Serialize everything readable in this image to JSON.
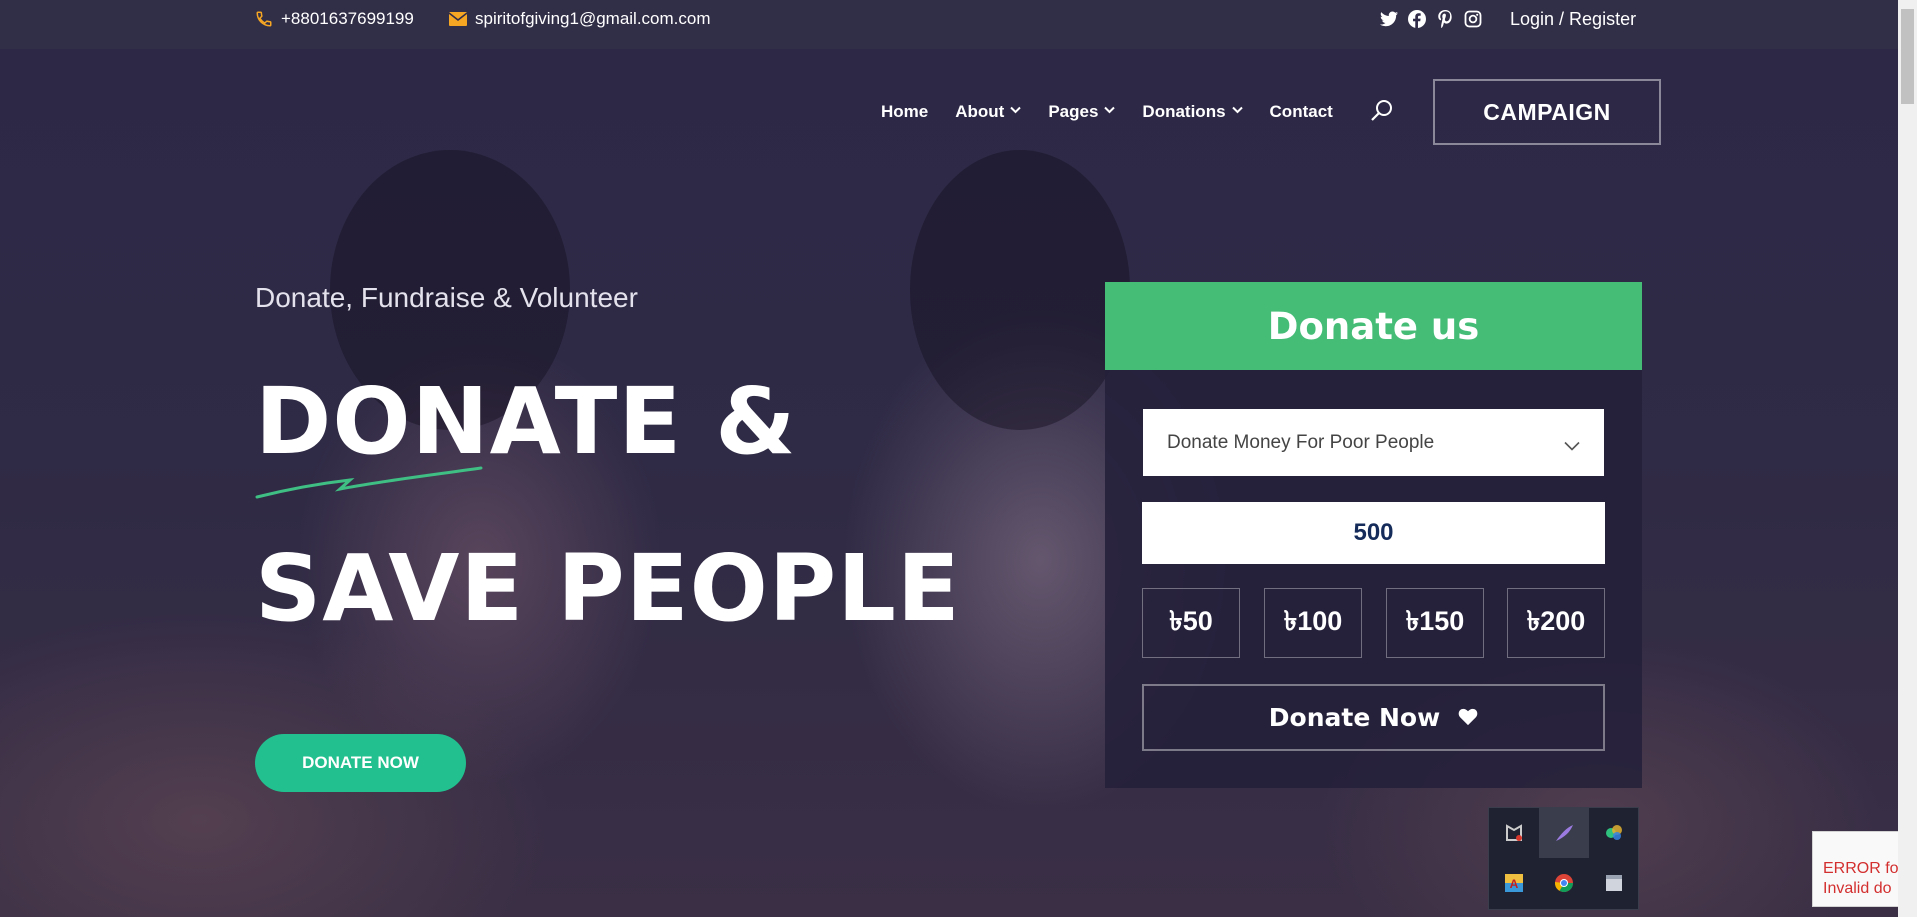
{
  "topbar": {
    "phone": "+8801637699199",
    "email": "spiritofgiving1@gmail.com.com",
    "socials": [
      "twitter-icon",
      "facebook-icon",
      "pinterest-icon",
      "instagram-icon"
    ],
    "login": "Login / Register"
  },
  "nav": {
    "items": [
      {
        "label": "Home",
        "dropdown": false
      },
      {
        "label": "About",
        "dropdown": true
      },
      {
        "label": "Pages",
        "dropdown": true
      },
      {
        "label": "Donations",
        "dropdown": true
      },
      {
        "label": "Contact",
        "dropdown": false
      }
    ],
    "campaign": "CAMPAIGN"
  },
  "hero": {
    "tagline": "Donate, Fundraise & Volunteer",
    "line1": "DONATE &",
    "line2": "SAVE PEOPLE",
    "cta": "DONATE NOW"
  },
  "card": {
    "title": "Donate us",
    "select_value": "Donate Money For Poor People",
    "amount": "500",
    "presets": [
      "৳50",
      "৳100",
      "৳150",
      "৳200"
    ],
    "donate_button": "Donate Now"
  },
  "recaptcha": {
    "line1": "ERROR fo",
    "line2": "Invalid do"
  },
  "colors": {
    "accent_green": "#45bd77",
    "pill_green": "#22c08e",
    "phone_icon": "#f5a623"
  }
}
